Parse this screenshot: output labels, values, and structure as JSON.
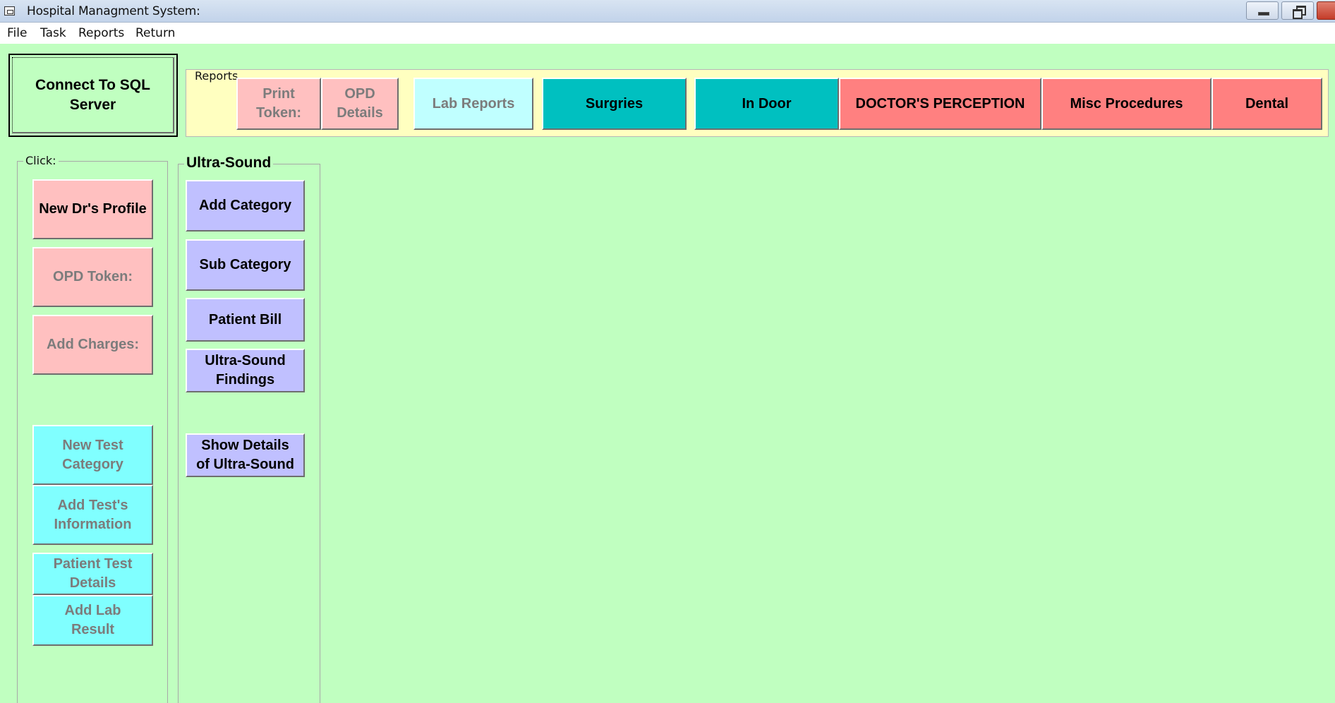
{
  "window": {
    "title": "Hospital Managment System:",
    "icon": "app-window-icon"
  },
  "menu": [
    "File",
    "Task",
    "Reports",
    "Return"
  ],
  "connect_button": "Connect To SQL\nServer",
  "reports": {
    "legend": "Reports",
    "buttons": [
      {
        "label": "Print\nToken:",
        "style": "pink",
        "enabled": false
      },
      {
        "label": "OPD\nDetails",
        "style": "pink",
        "enabled": false
      },
      {
        "label": "Lab Reports",
        "style": "light-cyan",
        "enabled": false
      },
      {
        "label": "Surgries",
        "style": "teal",
        "enabled": true
      },
      {
        "label": "In Door",
        "style": "teal",
        "enabled": true
      },
      {
        "label": "DOCTOR'S PERCEPTION",
        "style": "red",
        "enabled": true
      },
      {
        "label": "Misc Procedures",
        "style": "red",
        "enabled": true
      },
      {
        "label": "Dental",
        "style": "red",
        "enabled": true
      }
    ]
  },
  "click_panel": {
    "legend": "Click:",
    "buttons": [
      {
        "label": "New Dr's Profile",
        "style": "pink",
        "enabled": true
      },
      {
        "label": "OPD Token:",
        "style": "pink",
        "enabled": false
      },
      {
        "label": "Add Charges:",
        "style": "pink",
        "enabled": false
      },
      {
        "label": "New Test\nCategory",
        "style": "cyan",
        "enabled": false
      },
      {
        "label": "Add Test's\nInformation",
        "style": "cyan",
        "enabled": false
      },
      {
        "label": "Patient Test\nDetails",
        "style": "cyan",
        "enabled": false
      },
      {
        "label": "Add Lab\nResult",
        "style": "cyan",
        "enabled": false
      }
    ]
  },
  "ultrasound_panel": {
    "legend": "Ultra-Sound",
    "buttons": [
      {
        "label": "Add Category"
      },
      {
        "label": "Sub Category"
      },
      {
        "label": "Patient Bill"
      },
      {
        "label": "Ultra-Sound\nFindings"
      },
      {
        "label": "Show Details\nof Ultra-Sound"
      }
    ]
  },
  "colors": {
    "background": "#c0ffc0",
    "reports_background": "#ffffc0",
    "pink": "#ffc0c0",
    "cyan": "#80ffff",
    "light_cyan": "#c0ffff",
    "teal": "#00c0c0",
    "red": "#ff8080",
    "lavender": "#c0c0ff",
    "disabled_text": "#7c7c7c"
  }
}
